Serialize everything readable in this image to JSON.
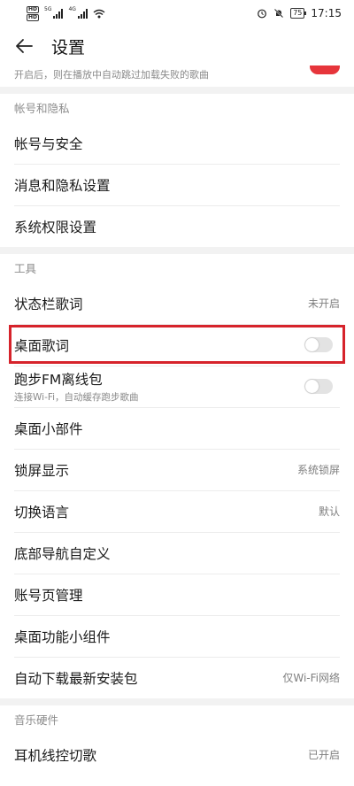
{
  "statusbar": {
    "hd1": "HD",
    "hd2": "HD",
    "sig1_tag": "5G",
    "sig2_tag": "4G",
    "battery": "75",
    "time": "17:15",
    "icons": [
      "hd-icon",
      "signal-icon",
      "wifi-icon",
      "alarm-icon",
      "mute-icon",
      "battery-icon"
    ]
  },
  "header": {
    "title": "设置"
  },
  "partial": {
    "subtitle": "开启后，则在播放中自动跳过加载失败的歌曲"
  },
  "sections": {
    "account": {
      "title": "帐号和隐私",
      "rows": [
        "帐号与安全",
        "消息和隐私设置",
        "系统权限设置"
      ]
    },
    "tools": {
      "title": "工具",
      "statusbar_lyrics": {
        "label": "状态栏歌词",
        "value": "未开启"
      },
      "desktop_lyrics": {
        "label": "桌面歌词",
        "toggle": "off"
      },
      "running_fm": {
        "label": "跑步FM离线包",
        "sub": "连接Wi-Fi，自动缓存跑步歌曲",
        "toggle": "off"
      },
      "desktop_widget": {
        "label": "桌面小部件"
      },
      "lockscreen": {
        "label": "锁屏显示",
        "value": "系统锁屏"
      },
      "language": {
        "label": "切换语言",
        "value": "默认"
      },
      "bottom_nav": {
        "label": "底部导航自定义"
      },
      "account_page": {
        "label": "账号页管理"
      },
      "desktop_func_widget": {
        "label": "桌面功能小组件"
      },
      "auto_download": {
        "label": "自动下载最新安装包",
        "value": "仅Wi-Fi网络"
      }
    },
    "hardware": {
      "title": "音乐硬件",
      "headset": {
        "label": "耳机线控切歌",
        "value": "已开启"
      }
    }
  },
  "colors": {
    "accent": "#e6353b",
    "highlight": "#d6232b",
    "toggle_off": "#e3e3e3"
  }
}
